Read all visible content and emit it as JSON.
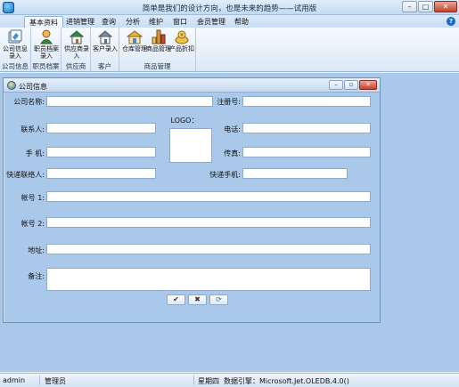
{
  "window": {
    "title": "简单是我们的设计方向，也是未来的趋势——试用版"
  },
  "menu": {
    "items": [
      "基本资料",
      "进销管理",
      "查询",
      "分析",
      "维护",
      "窗口",
      "会员管理",
      "帮助"
    ],
    "active": "基本资料"
  },
  "ribbon": {
    "groups": [
      {
        "label": "公司信息",
        "buttons": [
          {
            "label": "公司信息录入",
            "icon": "company-info-icon"
          }
        ]
      },
      {
        "label": "职员档案",
        "buttons": [
          {
            "label": "职员档案录入",
            "icon": "staff-file-icon"
          }
        ]
      },
      {
        "label": "供应商",
        "buttons": [
          {
            "label": "供应商录入",
            "icon": "supplier-house-icon"
          }
        ]
      },
      {
        "label": "客户",
        "buttons": [
          {
            "label": "客户录入",
            "icon": "customer-house-icon"
          }
        ]
      },
      {
        "label": "商品管理",
        "buttons": [
          {
            "label": "仓库管理",
            "icon": "warehouse-icon"
          },
          {
            "label": "商品管理",
            "icon": "goods-icon"
          },
          {
            "label": "产品折扣",
            "icon": "discount-icon"
          }
        ]
      }
    ]
  },
  "company_form": {
    "title": "公司信息",
    "labels": {
      "name": "公司名称:",
      "reg": "注册号:",
      "logo": "LOGO：",
      "contact": "联系人:",
      "phone": "电话:",
      "mobile": "手  机:",
      "fax": "传真:",
      "express_contact": "快递联络人:",
      "express_mobile": "快递手机:",
      "account1": "帐号 1:",
      "account2": "帐号 2:",
      "address": "地址:",
      "remark": "备注:"
    },
    "values": {
      "name": "",
      "reg": "",
      "contact": "",
      "phone": "",
      "mobile": "",
      "fax": "",
      "express_contact": "",
      "express_mobile": "",
      "account1": "",
      "account2": "",
      "address": "",
      "remark": ""
    },
    "buttons": {
      "confirm": "✔",
      "cancel": "✖",
      "refresh": "⟳"
    }
  },
  "statusbar": {
    "user": "admin",
    "role": "管理员",
    "weekday": "星期四",
    "engine": "数据引擎：Microsoft.Jet.OLEDB.4.0()"
  }
}
